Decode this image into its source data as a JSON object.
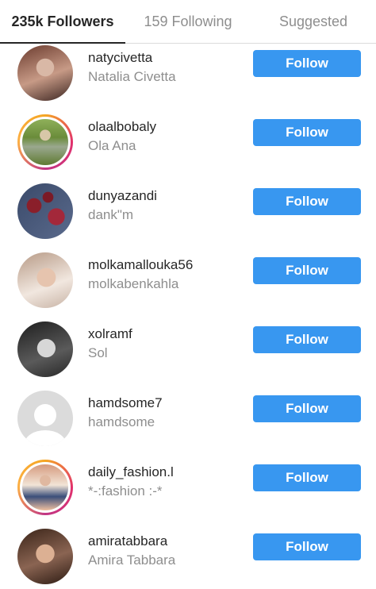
{
  "tabs": [
    {
      "label": "235k Followers",
      "active": true
    },
    {
      "label": "159 Following",
      "active": false
    },
    {
      "label": "Suggested",
      "active": false
    }
  ],
  "follow_label": "Follow",
  "accent_color": "#3897f0",
  "users": [
    {
      "username": "natycivetta",
      "fullname": "Natalia Civetta",
      "story": false
    },
    {
      "username": "olaalbobaly",
      "fullname": "Ola Ana",
      "story": true
    },
    {
      "username": "dunyazandi",
      "fullname": "dank\"m",
      "story": false
    },
    {
      "username": "molkamallouka56",
      "fullname": "molkabenkahla",
      "story": false
    },
    {
      "username": "xolramf",
      "fullname": "Sol",
      "story": false
    },
    {
      "username": "hamdsome7",
      "fullname": "hamdsome",
      "story": false
    },
    {
      "username": "daily_fashion.l",
      "fullname": "*-:fashion :-*",
      "story": true
    },
    {
      "username": "amiratabbara",
      "fullname": "Amira Tabbara",
      "story": false
    }
  ]
}
